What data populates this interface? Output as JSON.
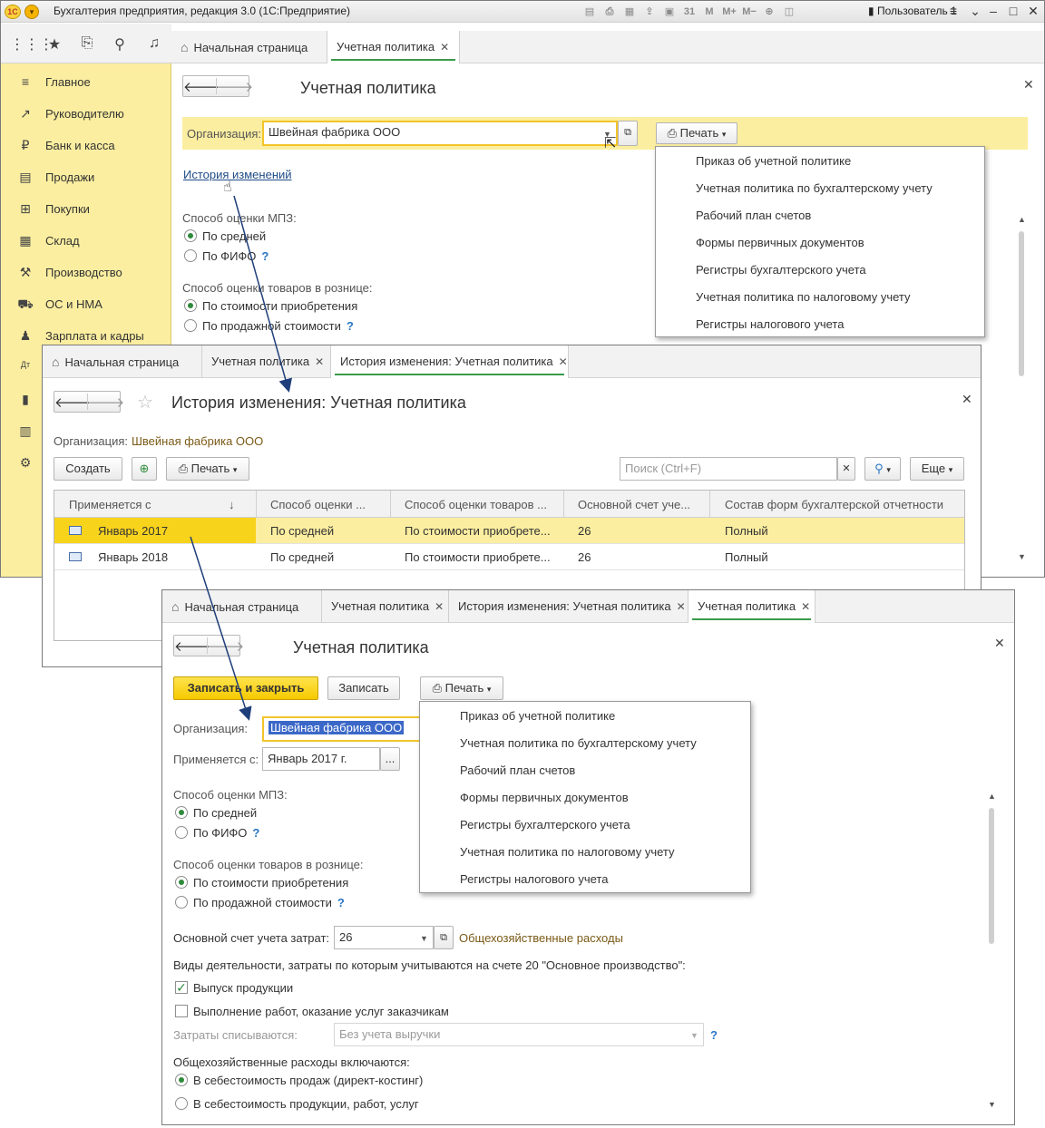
{
  "app": {
    "title": "Бухгалтерия предприятия, редакция 3.0  (1С:Предприятие)",
    "logo": "1С",
    "user": "Пользователь 1",
    "tb_icons": [
      "▤",
      "⎙",
      "▦",
      "⇪",
      "▣",
      "31",
      "M",
      "M+",
      "M−",
      "⊕",
      "◫"
    ],
    "accent": "#3a9a4a",
    "brand_yellow": "#fbeea0"
  },
  "sidebar": {
    "items": [
      {
        "label": "Главное",
        "icon": "≡"
      },
      {
        "label": "Руководителю",
        "icon": "↗"
      },
      {
        "label": "Банк и касса",
        "icon": "₽"
      },
      {
        "label": "Продажи",
        "icon": "▤"
      },
      {
        "label": "Покупки",
        "icon": "⊞"
      },
      {
        "label": "Склад",
        "icon": "▦"
      },
      {
        "label": "Производство",
        "icon": "⚒"
      },
      {
        "label": "ОС и НМА",
        "icon": "⛟"
      },
      {
        "label": "Зарплата и кадры",
        "icon": "♟"
      },
      {
        "label": "",
        "icon": "Дт"
      },
      {
        "label": "",
        "icon": "▮"
      },
      {
        "label": "",
        "icon": "▥"
      },
      {
        "label": "",
        "icon": "⚙"
      }
    ]
  },
  "w1": {
    "tabs": {
      "home": "Начальная страница",
      "policy": "Учетная политика"
    },
    "form_title": "Учетная политика",
    "org_label": "Организация:",
    "org_value": "Швейная фабрика ООО",
    "print": "Печать",
    "history_link": "История изменений",
    "mpz_label": "Способ оценки МПЗ:",
    "mpz_opt1": "По средней",
    "mpz_opt2": "По ФИФО",
    "retail_label": "Способ оценки товаров в рознице:",
    "retail_opt1": "По стоимости приобретения",
    "retail_opt2": "По продажной стоимости",
    "help": "?",
    "menu": [
      "Приказ об учетной политике",
      "Учетная политика по бухгалтерскому учету",
      "Рабочий план счетов",
      "Формы первичных документов",
      "Регистры бухгалтерского учета",
      "Учетная политика по налоговому учету",
      "Регистры налогового учета"
    ]
  },
  "w2": {
    "tabs": {
      "home": "Начальная страница",
      "policy": "Учетная политика",
      "history": "История изменения: Учетная политика"
    },
    "form_title": "История изменения: Учетная политика",
    "org_label": "Организация:",
    "org_value": "Швейная фабрика ООО",
    "create": "Создать",
    "print": "Печать",
    "search_placeholder": "Поиск (Ctrl+F)",
    "more": "Еще",
    "columns": [
      "Применяется с",
      "Способ оценки ...",
      "Способ оценки товаров ...",
      "Основной счет уче...",
      "Состав форм бухгалтерской отчетности"
    ],
    "rows": [
      [
        "Январь 2017",
        "По средней",
        "По стоимости приобрете...",
        "26",
        "Полный"
      ],
      [
        "Январь 2018",
        "По средней",
        "По стоимости приобрете...",
        "26",
        "Полный"
      ]
    ]
  },
  "w3": {
    "tabs": {
      "home": "Начальная страница",
      "policy": "Учетная политика",
      "history": "История изменения: Учетная политика",
      "policy2": "Учетная политика"
    },
    "form_title": "Учетная политика",
    "save_close": "Записать и закрыть",
    "save": "Записать",
    "print": "Печать",
    "org_label": "Организация:",
    "org_value": "Швейная фабрика ООО",
    "applies_label": "Применяется с:",
    "applies_value": "Январь 2017 г.",
    "ellipsis": "...",
    "mpz_label": "Способ оценки МПЗ:",
    "mpz_opt1": "По средней",
    "mpz_opt2": "По ФИФО",
    "retail_label": "Способ оценки товаров в рознице:",
    "retail_opt1": "По стоимости приобретения",
    "retail_opt2": "По продажной стоимости",
    "account_label": "Основной счет учета затрат:",
    "account_value": "26",
    "account_desc": "Общехозяйственные расходы",
    "activity_label": "Виды деятельности, затраты по которым учитываются на счете 20 \"Основное производство\":",
    "act1": "Выпуск продукции",
    "act2": "Выполнение работ, оказание услуг заказчикам",
    "writeoff_label": "Затраты списываются:",
    "writeoff_value": "Без учета выручки",
    "overhead_label": "Общехозяйственные расходы включаются:",
    "overhead_opt1": "В себестоимость продаж (директ-костинг)",
    "overhead_opt2": "В  себестоимость продукции, работ, услуг",
    "help": "?",
    "menu": [
      "Приказ об учетной политике",
      "Учетная политика по бухгалтерскому учету",
      "Рабочий план счетов",
      "Формы первичных документов",
      "Регистры бухгалтерского учета",
      "Учетная политика по налоговому учету",
      "Регистры налогового учета"
    ]
  }
}
